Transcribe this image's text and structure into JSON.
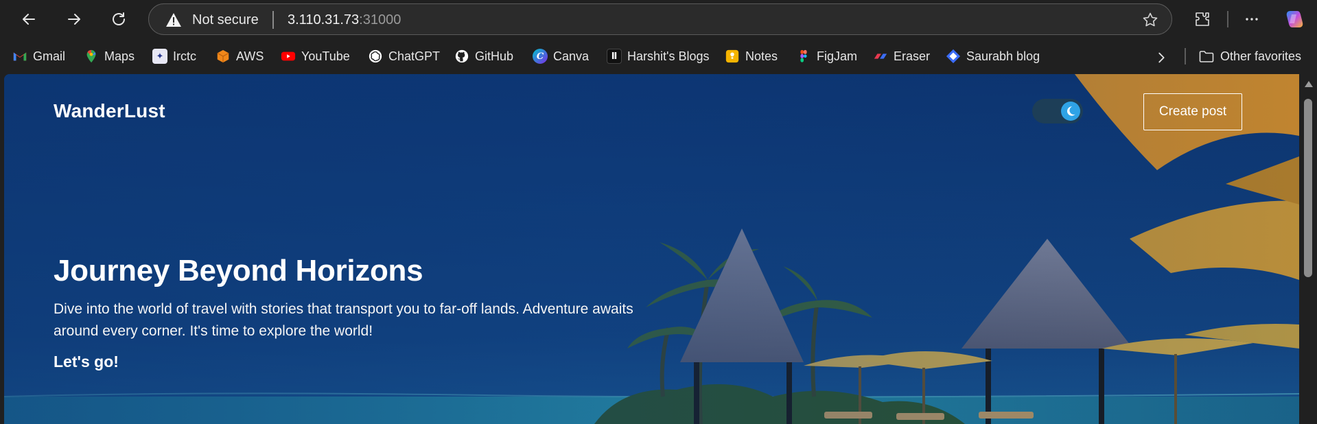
{
  "address_bar": {
    "security_label": "Not secure",
    "host": "3.110.31.73",
    "port": ":31000"
  },
  "bookmarks": [
    {
      "label": "Gmail",
      "icon": "gmail-icon",
      "color": "#ea4335"
    },
    {
      "label": "Maps",
      "icon": "maps-icon",
      "color": "#34a853"
    },
    {
      "label": "Irctc",
      "icon": "irctc-icon",
      "color": "#2b3a8f"
    },
    {
      "label": "AWS",
      "icon": "aws-icon",
      "color": "#f0871a"
    },
    {
      "label": "YouTube",
      "icon": "youtube-icon",
      "color": "#ff0000"
    },
    {
      "label": "ChatGPT",
      "icon": "chatgpt-icon",
      "color": "#ffffff"
    },
    {
      "label": "GitHub",
      "icon": "github-icon",
      "color": "#ffffff"
    },
    {
      "label": "Canva",
      "icon": "canva-icon",
      "color": "#7d2ae8"
    },
    {
      "label": "Harshit's Blogs",
      "icon": "hashnode-icon",
      "color": "#111111"
    },
    {
      "label": "Notes",
      "icon": "notes-icon",
      "color": "#f6b400"
    },
    {
      "label": "FigJam",
      "icon": "figma-icon",
      "color": "#a259ff"
    },
    {
      "label": "Eraser",
      "icon": "eraser-icon",
      "color": "#e8394f"
    },
    {
      "label": "Saurabh blog",
      "icon": "blog-icon",
      "color": "#3b6cf6"
    }
  ],
  "other_favorites_label": "Other favorites",
  "page": {
    "brand": "WanderLust",
    "create_post_label": "Create post",
    "hero_title": "Journey Beyond Horizons",
    "hero_description": "Dive into the world of travel with stories that transport you to far-off lands. Adventure awaits around every corner. It's time to explore the world!",
    "cta_label": "Let's go!",
    "theme_toggle": "dark"
  },
  "colors": {
    "browser_chrome": "#202020",
    "hero_blue": "#0f3a78",
    "toggle_knob": "#2fa3e6"
  }
}
